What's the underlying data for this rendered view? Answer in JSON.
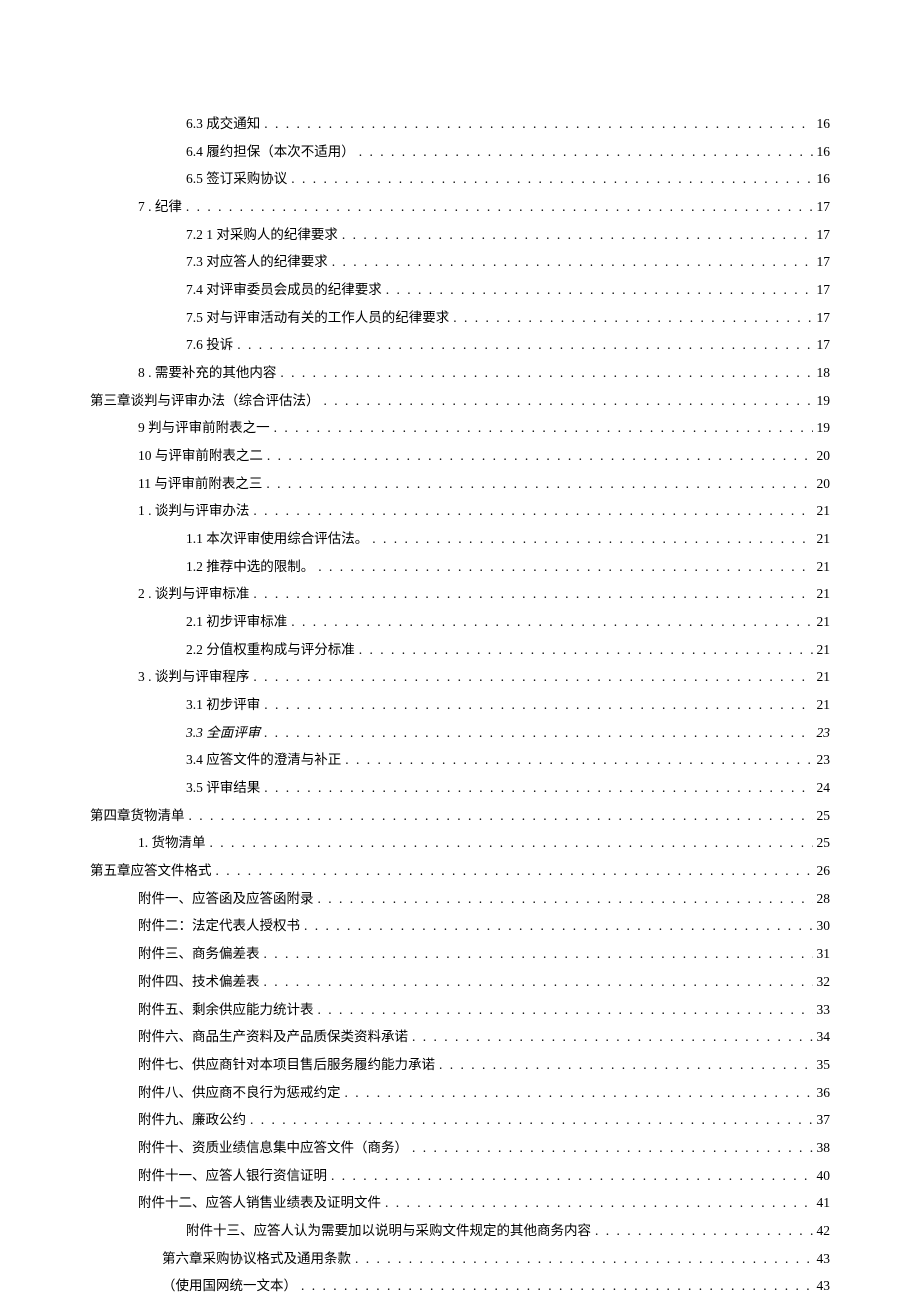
{
  "toc": [
    {
      "indent": 4,
      "label": "6.3    成交通知 ",
      "page": " 16",
      "italic": false
    },
    {
      "indent": 4,
      "label": "6.4    履约担保（本次不适用） ",
      "page": " 16",
      "italic": false
    },
    {
      "indent": 4,
      "label": "6.5    签订采购协议 ",
      "page": " 16",
      "italic": false
    },
    {
      "indent": 2,
      "label": "7    . 纪律 ",
      "page": " 17",
      "italic": false
    },
    {
      "indent": 4,
      "label": "7.2  1 对采购人的纪律要求 ",
      "page": " 17",
      "italic": false
    },
    {
      "indent": 4,
      "label": "7.3    对应答人的纪律要求 ",
      "page": " 17",
      "italic": false
    },
    {
      "indent": 4,
      "label": "7.4    对评审委员会成员的纪律要求 ",
      "page": " 17",
      "italic": false
    },
    {
      "indent": 4,
      "label": "7.5    对与评审活动有关的工作人员的纪律要求 ",
      "page": " 17",
      "italic": false
    },
    {
      "indent": 4,
      "label": "7.6    投诉 ",
      "page": " 17",
      "italic": false
    },
    {
      "indent": 2,
      "label": "8    . 需要补充的其他内容 ",
      "page": " 18",
      "italic": false
    },
    {
      "indent": 0,
      "label": "第三章谈判与评审办法（综合评估法） ",
      "page": " 19",
      "italic": false
    },
    {
      "indent": 2,
      "label": "9      判与评审前附表之一 ",
      "page": " 19",
      "italic": false
    },
    {
      "indent": 2,
      "label": "10       与评审前附表之二 ",
      "page": " 20",
      "italic": false
    },
    {
      "indent": 2,
      "label": "11       与评审前附表之三 ",
      "page": " 20",
      "italic": false
    },
    {
      "indent": 2,
      "label": "1    . 谈判与评审办法 ",
      "page": " 21",
      "italic": false
    },
    {
      "indent": 4,
      "label": "1.1    本次评审使用综合评估法。",
      "page": " 21",
      "italic": false
    },
    {
      "indent": 4,
      "label": "1.2    推荐中选的限制。 ",
      "page": " 21",
      "italic": false
    },
    {
      "indent": 2,
      "label": "2    . 谈判与评审标准 ",
      "page": " 21",
      "italic": false
    },
    {
      "indent": 4,
      "label": "2.1    初步评审标准 ",
      "page": " 21",
      "italic": false
    },
    {
      "indent": 4,
      "label": "2.2    分值权重构成与评分标准 ",
      "page": " 21",
      "italic": false
    },
    {
      "indent": 2,
      "label": "3    . 谈判与评审程序 ",
      "page": " 21",
      "italic": false
    },
    {
      "indent": 4,
      "label": "3.1    初步评审 ",
      "page": " 21",
      "italic": false
    },
    {
      "indent": 4,
      "label": "3.3    全面评审 ",
      "page": " 23",
      "italic": true
    },
    {
      "indent": 4,
      "label": "3.4    应答文件的澄清与补正 ",
      "page": " 23",
      "italic": false
    },
    {
      "indent": 4,
      "label": "3.5    评审结果 ",
      "page": " 24",
      "italic": false
    },
    {
      "indent": 0,
      "label": "第四章货物清单 ",
      "page": " 25",
      "italic": false
    },
    {
      "indent": 2,
      "label": "1. 货物清单 ",
      "page": " 25",
      "italic": false
    },
    {
      "indent": 0,
      "label": "第五章应答文件格式 ",
      "page": " 26",
      "italic": false
    },
    {
      "indent": 2,
      "label": "附件一、应答函及应答函附录 ",
      "page": " 28",
      "italic": false
    },
    {
      "indent": 2,
      "label": "附件二：法定代表人授权书 ",
      "page": " 30",
      "italic": false
    },
    {
      "indent": 2,
      "label": "附件三、商务偏差表 ",
      "page": " 31",
      "italic": false
    },
    {
      "indent": 2,
      "label": "附件四、技术偏差表 ",
      "page": " 32",
      "italic": false
    },
    {
      "indent": 2,
      "label": "附件五、剩余供应能力统计表 ",
      "page": " 33",
      "italic": false
    },
    {
      "indent": 2,
      "label": "附件六、商品生产资料及产品质保类资料承诺 ",
      "page": " 34",
      "italic": false
    },
    {
      "indent": 2,
      "label": "附件七、供应商针对本项目售后服务履约能力承诺 ",
      "page": " 35",
      "italic": false
    },
    {
      "indent": 2,
      "label": "附件八、供应商不良行为惩戒约定 ",
      "page": " 36",
      "italic": false
    },
    {
      "indent": 2,
      "label": "附件九、廉政公约 ",
      "page": " 37",
      "italic": false
    },
    {
      "indent": 2,
      "label": "附件十、资质业绩信息集中应答文件（商务） ",
      "page": " 38",
      "italic": false
    },
    {
      "indent": 2,
      "label": "附件十一、应答人银行资信证明 ",
      "page": " 40",
      "italic": false
    },
    {
      "indent": 2,
      "label": "附件十二、应答人销售业绩表及证明文件 ",
      "page": " 41",
      "italic": false
    },
    {
      "indent": 4,
      "label": "附件十三、应答人认为需要加以说明与采购文件规定的其他商务内容 ",
      "page": " 42",
      "italic": false
    },
    {
      "indent": 3,
      "label": "第六章采购协议格式及通用条款 ",
      "page": " 43",
      "italic": false
    },
    {
      "indent": 3,
      "label": "（使用国网统一文本） ",
      "page": " 43",
      "italic": false
    }
  ]
}
